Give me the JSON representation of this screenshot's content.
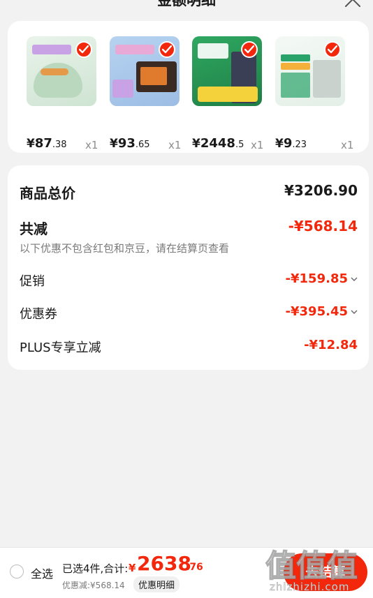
{
  "header": {
    "title": "金额明细"
  },
  "products": [
    {
      "price_currency": "¥",
      "price_int": "87",
      "price_dec": ".38",
      "qty": "x1",
      "thumb_colors": [
        "#dfeee0",
        "#b9d8be",
        "#c9a2e6"
      ]
    },
    {
      "price_currency": "¥",
      "price_int": "93",
      "price_dec": ".65",
      "qty": "x1",
      "thumb_colors": [
        "#a9c7ea",
        "#e8a9d6",
        "#3b2a22"
      ]
    },
    {
      "price_currency": "¥",
      "price_int": "2448",
      "price_dec": ".5",
      "qty": "x1",
      "thumb_colors": [
        "#2a9a55",
        "#f4d23c",
        "#3a3f55"
      ]
    },
    {
      "price_currency": "¥",
      "price_int": "9",
      "price_dec": ".23",
      "qty": "x1",
      "thumb_colors": [
        "#eef5f0",
        "#2aa36a",
        "#f3b13c"
      ]
    }
  ],
  "summary": {
    "total_label": "商品总价",
    "total_amount": "¥3206.90",
    "reduction_label": "共减",
    "reduction_amount": "-¥568.14",
    "note": "以下优惠不包含红包和京豆，请在结算页查看",
    "items": [
      {
        "label": "促销",
        "amount": "-¥159.85",
        "expandable": true
      },
      {
        "label": "优惠券",
        "amount": "-¥395.45",
        "expandable": true
      },
      {
        "label": "PLUS专享立减",
        "amount": "-¥12.84",
        "expandable": false
      }
    ]
  },
  "bottom_bar": {
    "select_all_label": "全选",
    "selected_text": "已选4件,合计:",
    "sum_currency": "¥",
    "sum_int": "2638",
    "sum_dec": ".76",
    "saved_text": "优惠减:¥568.14",
    "detail_toggle_label": "优惠明细",
    "checkout_label": "去结算",
    "watermark_glyphs": "值值值",
    "watermark_url": "zhizhizhi.com"
  },
  "colors": {
    "accent_red": "#f2270c",
    "background": "#f2f2f2",
    "card": "#ffffff"
  }
}
